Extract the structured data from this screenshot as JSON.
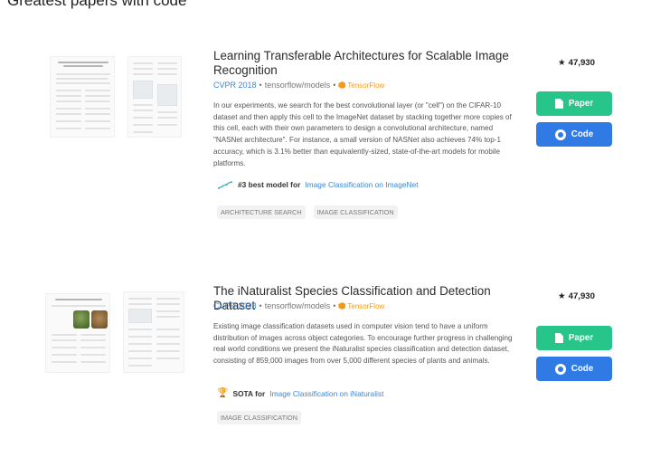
{
  "section_title": "Greatest papers with code",
  "papers": [
    {
      "title": "Learning Transferable Architectures for Scalable Image Recognition",
      "conference": "CVPR 2018",
      "repo": "tensorflow/models",
      "framework": "TensorFlow",
      "abstract": "In our experiments, we search for the best convolutional layer (or \"cell\") on the CIFAR-10 dataset and then apply this cell to the ImageNet dataset by stacking together more copies of this cell, each with their own parameters to design a convolutional architecture, named \"NASNet architecture\". For instance, a small version of NASNet also achieves 74% top-1 accuracy, which is 3.1% better than equivalently-sized, state-of-the-art models for mobile platforms.",
      "sota_rank": "#3 best model for",
      "sota_task": "Image Classification on ImageNet",
      "tags": [
        "ARCHITECTURE SEARCH",
        "IMAGE CLASSIFICATION"
      ],
      "stars": "47,930",
      "paper_label": "Paper",
      "code_label": "Code"
    },
    {
      "title": "The iNaturalist Species Classification and Detection Dataset",
      "conference": "CVPR 2018",
      "repo": "tensorflow/models",
      "framework": "TensorFlow",
      "abstract": "Existing image classification datasets used in computer vision tend to have a uniform distribution of images across object categories. To encourage further progress in challenging real world conditions we present the iNaturalist species classification and detection dataset, consisting of 859,000 images from over 5,000 different species of plants and animals.",
      "sota_rank": "SOTA for",
      "sota_task": "Image Classification on iNaturalist",
      "tags": [
        "IMAGE CLASSIFICATION"
      ],
      "stars": "47,930",
      "paper_label": "Paper",
      "code_label": "Code"
    }
  ],
  "colors": {
    "paper_button": "#27c58a",
    "code_button": "#2f7ae5",
    "link": "#3a87d9",
    "tensorflow": "#f49a1a"
  }
}
